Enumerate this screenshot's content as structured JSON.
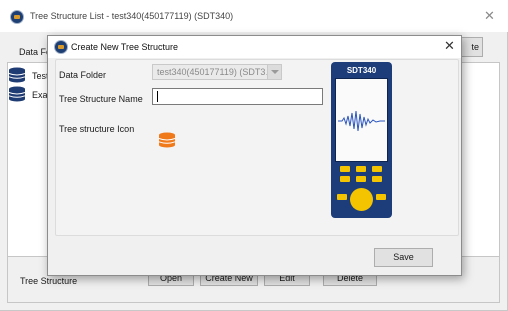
{
  "background_window": {
    "title": "Tree Structure List - test340(450177119) (SDT340)",
    "toolbar_label": "Data Fo",
    "right_button_label": "te",
    "tree_items": [
      {
        "label": "Test"
      },
      {
        "label": "Exan"
      }
    ],
    "bottom_label": "Tree Structure",
    "buttons": {
      "open": "Open",
      "create_new": "Create New",
      "edit": "Edit",
      "delete": "Delete"
    }
  },
  "dialog": {
    "title": "Create New Tree Structure",
    "data_folder_label": "Data Folder",
    "data_folder_value": "test340(450177119) (SDT3…",
    "tree_structure_name_label": "Tree Structure Name",
    "tree_structure_name_value": "",
    "tree_structure_icon_label": "Tree structure Icon",
    "save_label": "Save"
  },
  "device": {
    "brand": "SDT340"
  },
  "colors": {
    "device_body": "#1d3d7a",
    "device_keys": "#f4c400",
    "db_icon_orange": "#f07a1a",
    "db_icon_navy": "#1f3b73"
  },
  "icons": {
    "app": "sdt-logo-icon",
    "tree_item": "database-icon",
    "tree_structure": "database-icon"
  }
}
